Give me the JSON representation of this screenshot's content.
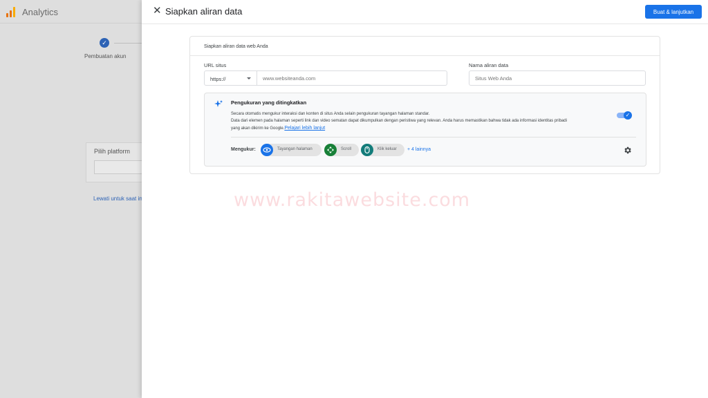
{
  "background": {
    "app_title": "Analytics",
    "step_check": "✓",
    "step_label": "Pembuatan akun",
    "platform_title": "Pilih platform",
    "skip_link": "Lewati untuk saat ini"
  },
  "panel": {
    "close_glyph": "✕",
    "title": "Siapkan aliran data",
    "primary_button": "Buat & lanjutkan",
    "card_title": "Siapkan aliran data web Anda",
    "url_label": "URL situs",
    "protocol_value": "https://",
    "url_placeholder": "www.websiteanda.com",
    "name_label": "Nama aliran data",
    "name_placeholder": "Situs Web Anda",
    "enhanced": {
      "title": "Pengukuran yang ditingkatkan",
      "desc1": "Secara otomatis mengukur interaksi dan konten di situs Anda selain pengukuran tayangan halaman standar.",
      "desc2": "Data dari elemen pada halaman seperti link dan video sematan dapat dikumpulkan dengan peristiwa yang relevan. Anda harus memastikan bahwa tidak ada informasi identitas pribadi",
      "desc3": "yang akan dikirim ke Google.",
      "learn_more": "Pelajari lebih lanjut",
      "toggle_on": true,
      "measure_label": "Mengukur:",
      "chips": [
        {
          "label": "Tayangan halaman",
          "icon": "eye-icon",
          "color": "#1a73e8"
        },
        {
          "label": "Scroll",
          "icon": "scroll-icon",
          "color": "#188038"
        },
        {
          "label": "Klik keluar",
          "icon": "mouse-icon",
          "color": "#137c7a"
        }
      ],
      "more": "+ 4 lainnya"
    }
  },
  "watermark": "www.rakitawebsite.com",
  "colors": {
    "primary": "#1a73e8",
    "overlay": "#dedede"
  }
}
